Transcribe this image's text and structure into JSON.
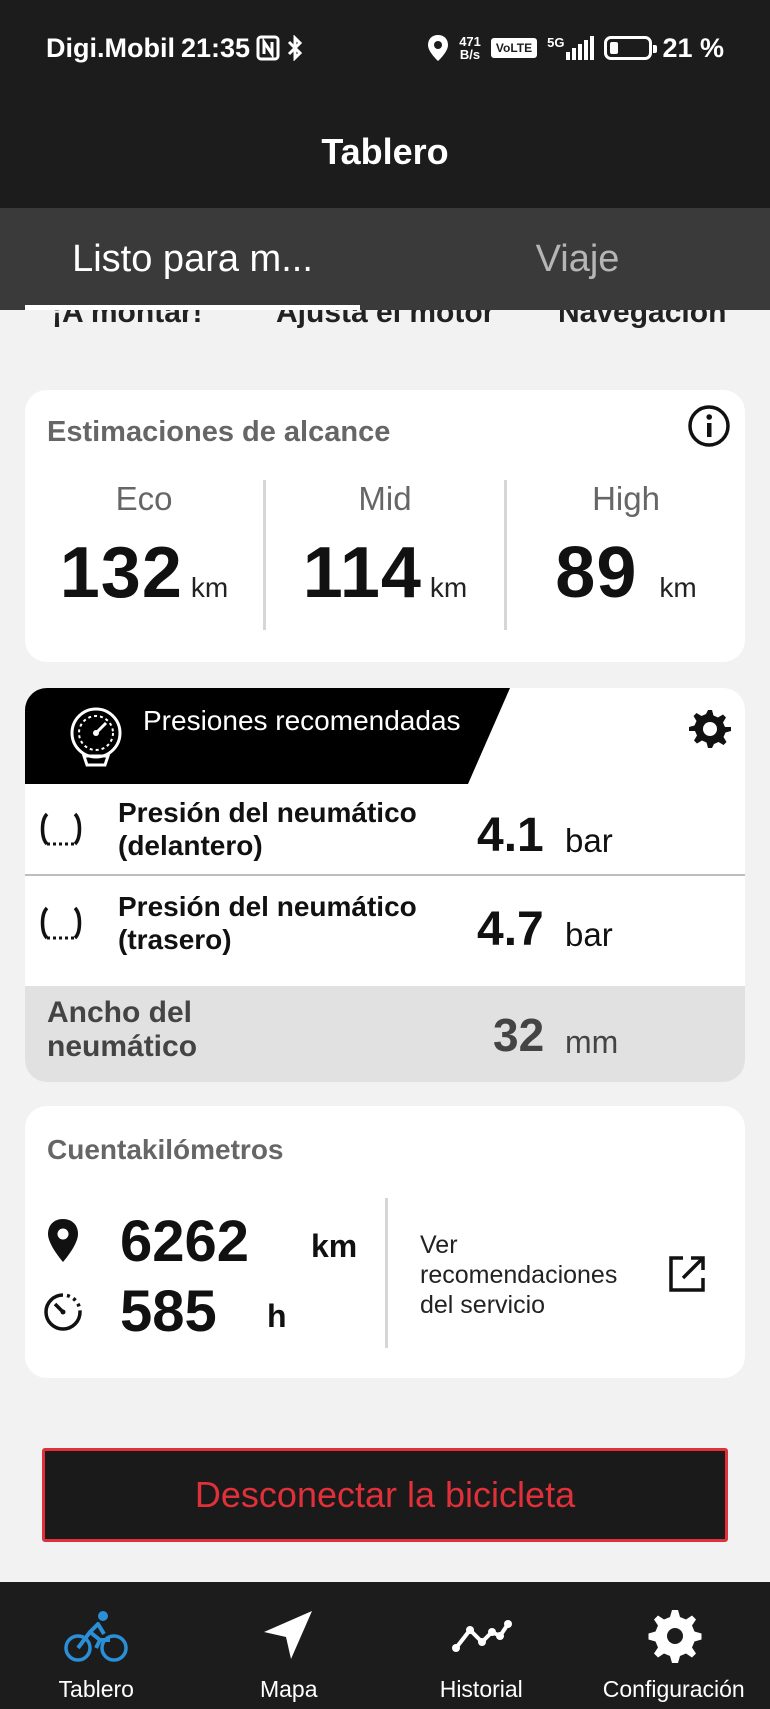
{
  "status_bar": {
    "carrier": "Digi.Mobil",
    "time": "21:35",
    "net_speed_value": "471",
    "net_speed_unit": "B/s",
    "volte": "VoLTE",
    "network": "5G",
    "battery": "21 %",
    "battery_level": 0.21
  },
  "header": {
    "title": "Tablero"
  },
  "tabs": [
    {
      "label": "Listo para m...",
      "active": true
    },
    {
      "label": "Viaje",
      "active": false
    }
  ],
  "subnav": [
    "¡A montar!",
    "Ajusta el motor",
    "Navegación"
  ],
  "range": {
    "title": "Estimaciones de alcance",
    "modes": [
      {
        "label": "Eco",
        "value": "132",
        "unit": "km"
      },
      {
        "label": "Mid",
        "value": "114",
        "unit": "km"
      },
      {
        "label": "High",
        "value": "89",
        "unit": "km"
      }
    ]
  },
  "pressure": {
    "title": "Presiones recomendadas",
    "front": {
      "label": "Presión del neumático (delantero)",
      "value": "4.1",
      "unit": "bar"
    },
    "rear": {
      "label": "Presión del neumático (trasero)",
      "value": "4.7",
      "unit": "bar"
    },
    "width": {
      "label": "Ancho del neumático",
      "value": "32",
      "unit": "mm"
    }
  },
  "odometer": {
    "title": "Cuentakilómetros",
    "distance": {
      "value": "6262",
      "unit": "km"
    },
    "hours": {
      "value": "585",
      "unit": "h"
    },
    "service_link": "Ver recomendaciones del servicio"
  },
  "disconnect_label": "Desconectar la bicicleta",
  "bottom_nav": [
    {
      "label": "Tablero",
      "icon": "bike-icon",
      "active": true
    },
    {
      "label": "Mapa",
      "icon": "navigation-arrow-icon",
      "active": false
    },
    {
      "label": "Historial",
      "icon": "chart-line-icon",
      "active": false
    },
    {
      "label": "Configuración",
      "icon": "gear-icon",
      "active": false
    }
  ],
  "colors": {
    "accent_active": "#2a8fd6",
    "disconnect_red": "#e0303a",
    "header_bg": "#1c1c1c"
  }
}
